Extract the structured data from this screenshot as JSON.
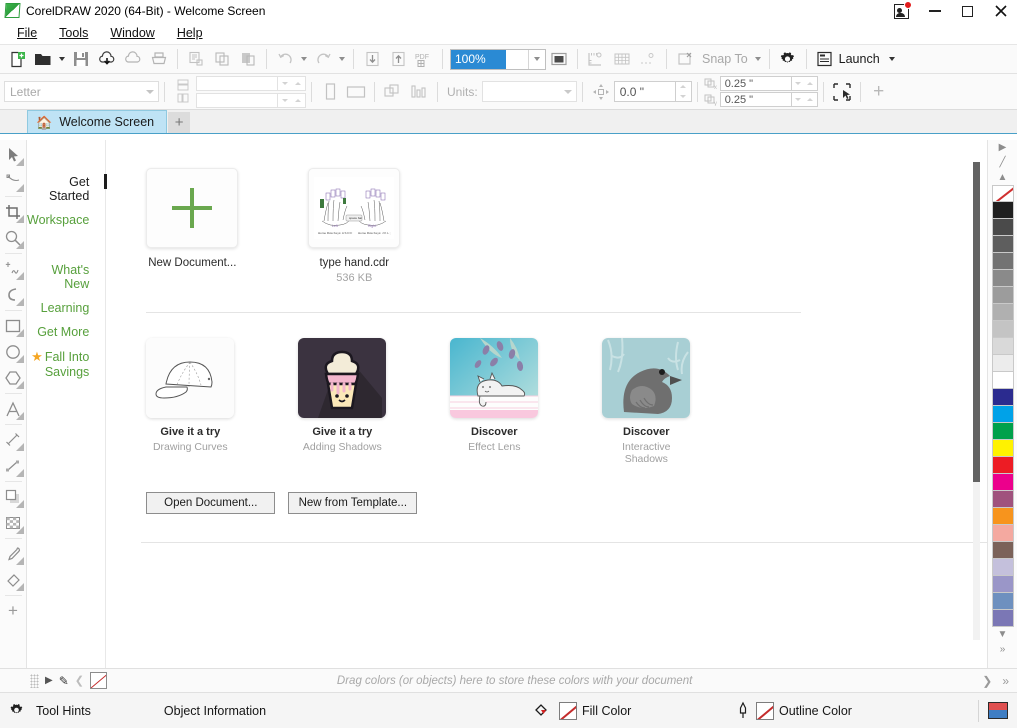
{
  "window": {
    "title": "CorelDRAW 2020 (64-Bit) - Welcome Screen",
    "logo_name": "coreldraw-logo",
    "buttons": {
      "notifications": "notifications-icon",
      "minimize": "—",
      "maximize": "❐",
      "close": "✕"
    }
  },
  "menubar": {
    "items": [
      {
        "label": "File",
        "accel": "F"
      },
      {
        "label": "Tools",
        "accel": "o"
      },
      {
        "label": "Window",
        "accel": "W"
      },
      {
        "label": "Help",
        "accel": "H"
      }
    ]
  },
  "toolbar_main": {
    "icons": [
      "new-document-icon",
      "open-document-icon",
      "save-icon",
      "cloud-download-icon",
      "cloud-upload-icon",
      "print-icon",
      "cut-icon",
      "copy-icon",
      "paste-icon",
      "undo-icon",
      "redo-icon",
      "import-icon",
      "export-icon",
      "publish-pdf-icon"
    ],
    "zoom_level": "100%",
    "zoom_name": "zoom-level-input",
    "fullscreen_icon": "full-screen-preview-icon",
    "rulers_icon": "show-rulers-icon",
    "grid_icon": "show-grid-icon",
    "guides_icon": "show-guidelines-icon",
    "snap_icon": "snap-off-icon",
    "snap_to_label": "Snap To",
    "options_icon": "options-gear-icon",
    "launch_icon": "launch-panel-icon",
    "launch_label": "Launch"
  },
  "toolbar_property": {
    "paper_type": "Letter",
    "paper_placeholder": "Letter",
    "page_width": "",
    "page_height": "",
    "portrait_icon": "portrait-orientation-icon",
    "landscape_icon": "landscape-orientation-icon",
    "all_pages_icon": "all-pages-icon",
    "current_page_icon": "current-page-icon",
    "units_label": "Units:",
    "units_value": "",
    "nudge_icon": "nudge-offset-icon",
    "nudge_value": "0.0 \"",
    "duplicate_x_label": "x",
    "duplicate_x_value": "0.25 \"",
    "duplicate_y_label": "y",
    "duplicate_y_value": "0.25 \"",
    "treat_as_filled_icon": "treat-as-filled-icon",
    "add_icon": "add-toolbar-item-icon"
  },
  "tabs": {
    "home_icon": "home-icon",
    "items": [
      {
        "label": "Welcome Screen",
        "active": true
      }
    ],
    "new_tab_label": "+"
  },
  "toolbox": {
    "tools": [
      "pick-tool-icon",
      "shape-tool-icon",
      "crop-tool-icon",
      "zoom-tool-icon",
      "freehand-tool-icon",
      "artistic-media-tool-icon",
      "rectangle-tool-icon",
      "ellipse-tool-icon",
      "polygon-tool-icon",
      "text-tool-icon",
      "parallel-dimension-tool-icon",
      "straight-line-connector-icon",
      "drop-shadow-tool-icon",
      "transparency-tool-icon",
      "color-eyedropper-icon",
      "interactive-fill-icon",
      "add-tool-icon"
    ]
  },
  "welcome": {
    "nav": [
      {
        "label": "Get Started",
        "active": true,
        "star": false,
        "gap": false
      },
      {
        "label": "Workspace",
        "active": false,
        "star": false,
        "gap": false
      },
      {
        "label": "What's New",
        "active": false,
        "star": false,
        "gap": true
      },
      {
        "label": "Learning",
        "active": false,
        "star": false,
        "gap": false
      },
      {
        "label": "Get More",
        "active": false,
        "star": false,
        "gap": false
      },
      {
        "label": "Fall Into Savings",
        "active": false,
        "star": true,
        "gap": false
      }
    ],
    "documents": [
      {
        "title": "New Document...",
        "size": "",
        "kind": "new"
      },
      {
        "title": "type hand.cdr",
        "size": "536 KB",
        "kind": "file"
      }
    ],
    "cards": [
      {
        "heading": "Give it a try",
        "subject": "Drawing Curves",
        "art": "cap"
      },
      {
        "heading": "Give it a try",
        "subject": "Adding Shadows",
        "art": "cupcake"
      },
      {
        "heading": "Discover",
        "subject": "Effect Lens",
        "art": "cat"
      },
      {
        "heading": "Discover",
        "subject": "Interactive Shadows",
        "art": "bird"
      }
    ],
    "buttons": [
      {
        "label": "Open Document..."
      },
      {
        "label": "New from Template..."
      }
    ],
    "more_chevron": "chevron-down-icon"
  },
  "palette": {
    "top_controls": [
      "palette-scroll-up-icon",
      "eyedropper-icon",
      "palette-collapse-icon"
    ],
    "bottom_controls": [
      "palette-scroll-down-icon",
      "palette-expand-icon"
    ],
    "none_swatch": "no-color-swatch",
    "colors": [
      "#1f1f1f",
      "#4a4a4a",
      "#5e5e5e",
      "#737373",
      "#8a8a8a",
      "#9c9c9c",
      "#b0b0b0",
      "#c4c4c4",
      "#d9d9d9",
      "#ececec",
      "#ffffff",
      "#2b2b8f",
      "#00a2e8",
      "#00a14b",
      "#fff200",
      "#ed1c24",
      "#ec008c",
      "#a0527d",
      "#f7941d",
      "#f4a9a0",
      "#7b6259",
      "#c4c0dc",
      "#9a96c8",
      "#6e90bf",
      "#7b77b5"
    ]
  },
  "colorbar": {
    "hint": "Drag colors (or objects) here to store these colors with your document",
    "dots_icon": "drag-handle-icon",
    "arrow_icon": "palette-next-icon",
    "eyedropper_icon": "eyedropper-icon",
    "prev_icon": "palette-prev-icon",
    "none_swatch": "no-color-swatch",
    "right_icons": [
      "palette-scroll-right-icon",
      "palette-expand-icon"
    ]
  },
  "statusbar": {
    "gear_icon": "status-options-gear-icon",
    "tool_hints": "Tool Hints",
    "object_information": "Object Information",
    "fill_label": "Fill Color",
    "fill_icon": "fill-color-icon",
    "outline_label": "Outline Color",
    "outline_icon": "outline-color-icon",
    "screen_icon": "color-proof-icon"
  }
}
